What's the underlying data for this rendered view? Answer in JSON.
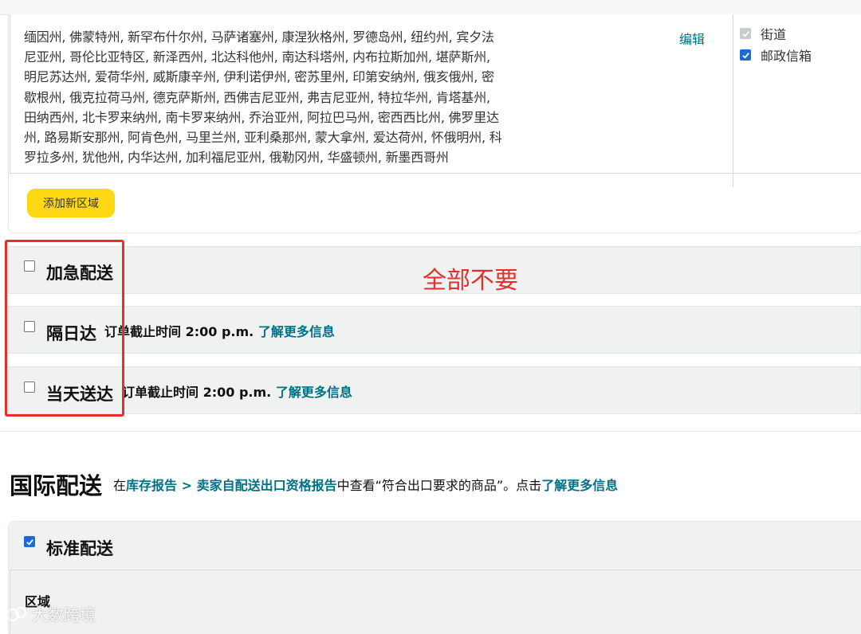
{
  "regions": {
    "states_line1": "缅因州, 佛蒙特州, 新罕布什尔州, 马萨诸塞州, 康涅狄格州, 罗德岛州, 纽约州, 宾夕法",
    "states_line2": "尼亚州, 哥伦比亚特区, 新泽西州, 北达科他州, 南达科塔州, 内布拉斯加州, 堪萨斯州,",
    "states_line3": "明尼苏达州, 爱荷华州, 威斯康辛州, 伊利诺伊州, 密苏里州, 印第安纳州, 俄亥俄州, 密",
    "states_line4": "歇根州, 俄克拉荷马州, 德克萨斯州, 西佛吉尼亚州, 弗吉尼亚州, 特拉华州, 肯塔基州,",
    "states_line5": "田纳西州, 北卡罗来纳州, 南卡罗来纳州, 乔治亚州, 阿拉巴马州, 密西西比州, 佛罗里达",
    "states_line6": "州, 路易斯安那州, 阿肯色州, 马里兰州, 亚利桑那州, 蒙大拿州, 爱达荷州, 怀俄明州, 科",
    "states_line7": "罗拉多州, 犹他州, 内华达州, 加利福尼亚州, 俄勒冈州, 华盛顿州, 新墨西哥州",
    "edit_label": "编辑",
    "address_types": [
      {
        "label": "街道",
        "checked": true,
        "disabled": true
      },
      {
        "label": "邮政信箱",
        "checked": true,
        "disabled": false
      }
    ],
    "add_region_label": "添加新区域"
  },
  "shipping_options": [
    {
      "label": "加急配送",
      "checked": false,
      "cutoff": "",
      "link": ""
    },
    {
      "label": "隔日达",
      "checked": false,
      "cutoff": "订单截止时间 2:00 p.m.",
      "link": "了解更多信息"
    },
    {
      "label": "当天送达",
      "checked": false,
      "cutoff": "订单截止时间 2:00 p.m.",
      "link": "了解更多信息"
    }
  ],
  "annotation": {
    "text": "全部不要",
    "color": "#e4302b"
  },
  "international": {
    "title": "国际配送",
    "desc_prefix": "在",
    "link1": "库存报告",
    "arrow": " > ",
    "link2": "卖家自配送出口资格报告",
    "desc_mid": "中查看“符合出口要求的商品”。点击",
    "link3": "了解更多信息",
    "standard_label": "标准配送",
    "standard_checked": true,
    "region_header": "区域"
  },
  "watermark": "大数跨境",
  "colors": {
    "link": "#007185",
    "button": "#ffd814",
    "checkbox": "#1a6ad8",
    "row_bg": "#f0f2f2"
  }
}
